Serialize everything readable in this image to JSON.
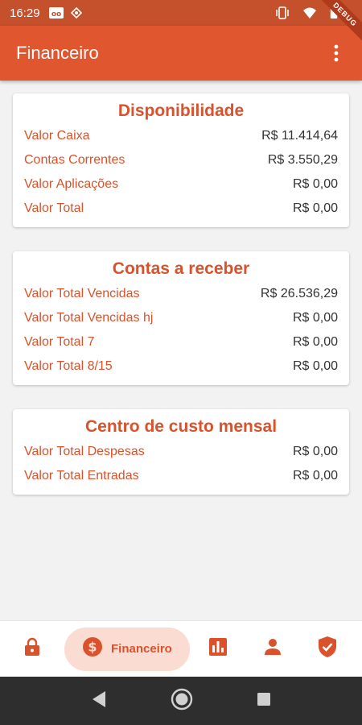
{
  "status_bar": {
    "time": "16:29",
    "icons": [
      "wear-icon",
      "diamond-icon",
      "vibrate-icon",
      "wifi-icon",
      "battery-icon"
    ]
  },
  "debug_banner": "DEBUG",
  "app_bar": {
    "title": "Financeiro",
    "menu_icon": "more-vert-icon"
  },
  "cards": [
    {
      "title": "Disponibilidade",
      "rows": [
        {
          "label": "Valor Caixa",
          "value": "R$ 11.414,64"
        },
        {
          "label": "Contas Correntes",
          "value": "R$ 3.550,29"
        },
        {
          "label": "Valor Aplicações",
          "value": "R$ 0,00"
        },
        {
          "label": "Valor Total",
          "value": "R$ 0,00"
        }
      ]
    },
    {
      "title": "Contas a receber",
      "rows": [
        {
          "label": "Valor Total Vencidas",
          "value": "R$ 26.536,29"
        },
        {
          "label": "Valor Total Vencidas hj",
          "value": "R$ 0,00"
        },
        {
          "label": "Valor Total 7",
          "value": "R$ 0,00"
        },
        {
          "label": "Valor Total 8/15",
          "value": "R$ 0,00"
        }
      ]
    },
    {
      "title": "Centro de custo mensal",
      "rows": [
        {
          "label": "Valor Total Despesas",
          "value": "R$ 0,00"
        },
        {
          "label": "Valor Total Entradas",
          "value": "R$ 0,00"
        }
      ]
    }
  ],
  "bottom_nav": {
    "items": [
      {
        "icon": "lock-icon"
      },
      {
        "icon": "dollar-icon",
        "label": "Financeiro",
        "active": true
      },
      {
        "icon": "bar-chart-icon"
      },
      {
        "icon": "person-icon"
      },
      {
        "icon": "verified-shield-icon"
      }
    ]
  },
  "system_nav": [
    "back-icon",
    "home-icon",
    "recents-icon"
  ],
  "colors": {
    "primary": "#e0562f",
    "status_bar": "#c4502c",
    "accent_text": "#d9522b",
    "active_pill": "#fbdcd2"
  }
}
